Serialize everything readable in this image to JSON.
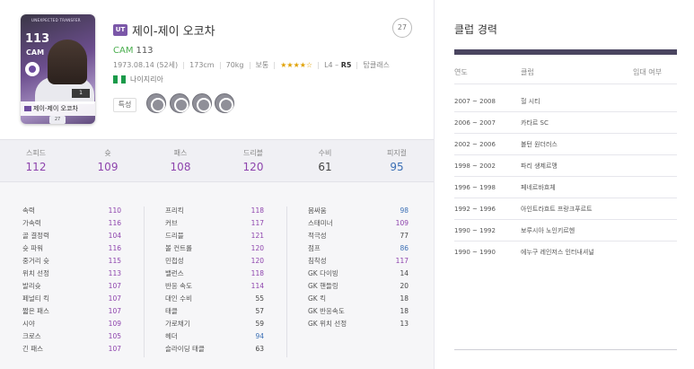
{
  "player": {
    "season_badge": "UT",
    "name": "제이-제이 오코차",
    "season_number": "27",
    "position": "CAM",
    "position_ovr": "113",
    "birth": "1973.08.14 (52세)",
    "height": "173cm",
    "weight": "70kg",
    "body_type": "보통",
    "skill_stars": "★★★★☆",
    "foot": "L4 –",
    "foot_strong": "R5",
    "reputation": "탑클래스",
    "nation": "나이지리아",
    "trait_label": "특성"
  },
  "card": {
    "tagline": "UNEXPECTED TRANSFER",
    "ovr": "113",
    "pos": "CAM",
    "number": "1",
    "badge": "UT",
    "name": "제이-제이 오코차",
    "level": "27"
  },
  "traits": [
    "trait-1-icon",
    "trait-2-icon",
    "trait-3-icon",
    "trait-4-icon"
  ],
  "summary": [
    {
      "label": "스피드",
      "value": "112",
      "tone": "high"
    },
    {
      "label": "슛",
      "value": "109",
      "tone": "high"
    },
    {
      "label": "패스",
      "value": "108",
      "tone": "high"
    },
    {
      "label": "드리블",
      "value": "120",
      "tone": "high"
    },
    {
      "label": "수비",
      "value": "61",
      "tone": "low"
    },
    {
      "label": "피지컬",
      "value": "95",
      "tone": "mid"
    }
  ],
  "stats": {
    "col1": [
      {
        "name": "속력",
        "value": "110",
        "tone": "high"
      },
      {
        "name": "가속력",
        "value": "116",
        "tone": "high"
      },
      {
        "name": "골 결정력",
        "value": "104",
        "tone": "high"
      },
      {
        "name": "슛 파워",
        "value": "116",
        "tone": "high"
      },
      {
        "name": "중거리 슛",
        "value": "115",
        "tone": "high"
      },
      {
        "name": "위치 선정",
        "value": "113",
        "tone": "high"
      },
      {
        "name": "발리슛",
        "value": "107",
        "tone": "high"
      },
      {
        "name": "페널티 킥",
        "value": "107",
        "tone": "high"
      },
      {
        "name": "짧은 패스",
        "value": "107",
        "tone": "high"
      },
      {
        "name": "시야",
        "value": "109",
        "tone": "high"
      },
      {
        "name": "크로스",
        "value": "105",
        "tone": "high"
      },
      {
        "name": "긴 패스",
        "value": "107",
        "tone": "high"
      }
    ],
    "col2": [
      {
        "name": "프리킥",
        "value": "118",
        "tone": "high"
      },
      {
        "name": "커브",
        "value": "117",
        "tone": "high"
      },
      {
        "name": "드리블",
        "value": "121",
        "tone": "high"
      },
      {
        "name": "볼 컨트롤",
        "value": "120",
        "tone": "high"
      },
      {
        "name": "민첩성",
        "value": "120",
        "tone": "high"
      },
      {
        "name": "밸런스",
        "value": "118",
        "tone": "high"
      },
      {
        "name": "반응 속도",
        "value": "114",
        "tone": "high"
      },
      {
        "name": "대인 수비",
        "value": "55",
        "tone": "low"
      },
      {
        "name": "태클",
        "value": "57",
        "tone": "low"
      },
      {
        "name": "가로채기",
        "value": "59",
        "tone": "low"
      },
      {
        "name": "헤더",
        "value": "94",
        "tone": "mid"
      },
      {
        "name": "슬라이딩 태클",
        "value": "63",
        "tone": "low"
      }
    ],
    "col3": [
      {
        "name": "몸싸움",
        "value": "98",
        "tone": "mid"
      },
      {
        "name": "스태미너",
        "value": "109",
        "tone": "high"
      },
      {
        "name": "적극성",
        "value": "77",
        "tone": "low"
      },
      {
        "name": "점프",
        "value": "86",
        "tone": "mid"
      },
      {
        "name": "침착성",
        "value": "117",
        "tone": "high"
      },
      {
        "name": "GK 다이빙",
        "value": "14",
        "tone": "low"
      },
      {
        "name": "GK 핸들링",
        "value": "20",
        "tone": "low"
      },
      {
        "name": "GK 킥",
        "value": "18",
        "tone": "low"
      },
      {
        "name": "GK 반응속도",
        "value": "18",
        "tone": "low"
      },
      {
        "name": "GK 위치 선정",
        "value": "13",
        "tone": "low"
      }
    ]
  },
  "club_history": {
    "title": "클럽 경력",
    "headers": {
      "year": "연도",
      "club": "클럽",
      "loan": "임대 여부"
    },
    "rows": [
      {
        "year": "2007 ~ 2008",
        "club": "헐 시티"
      },
      {
        "year": "2006 ~ 2007",
        "club": "카타르 SC"
      },
      {
        "year": "2002 ~ 2006",
        "club": "볼턴 원더러스"
      },
      {
        "year": "1998 ~ 2002",
        "club": "파리 생제르맹"
      },
      {
        "year": "1996 ~ 1998",
        "club": "페네르바흐체"
      },
      {
        "year": "1992 ~ 1996",
        "club": "아인트라흐트 프랑크푸르트"
      },
      {
        "year": "1990 ~ 1992",
        "club": "보루시아 노인키르헨"
      },
      {
        "year": "1990 ~ 1990",
        "club": "에누구 레인저스 인터내셔널"
      }
    ]
  },
  "colors": {
    "high": "#8e44ad",
    "mid": "#3b6fb5",
    "low": "#444444",
    "nation_green": "#1a9a4a"
  }
}
